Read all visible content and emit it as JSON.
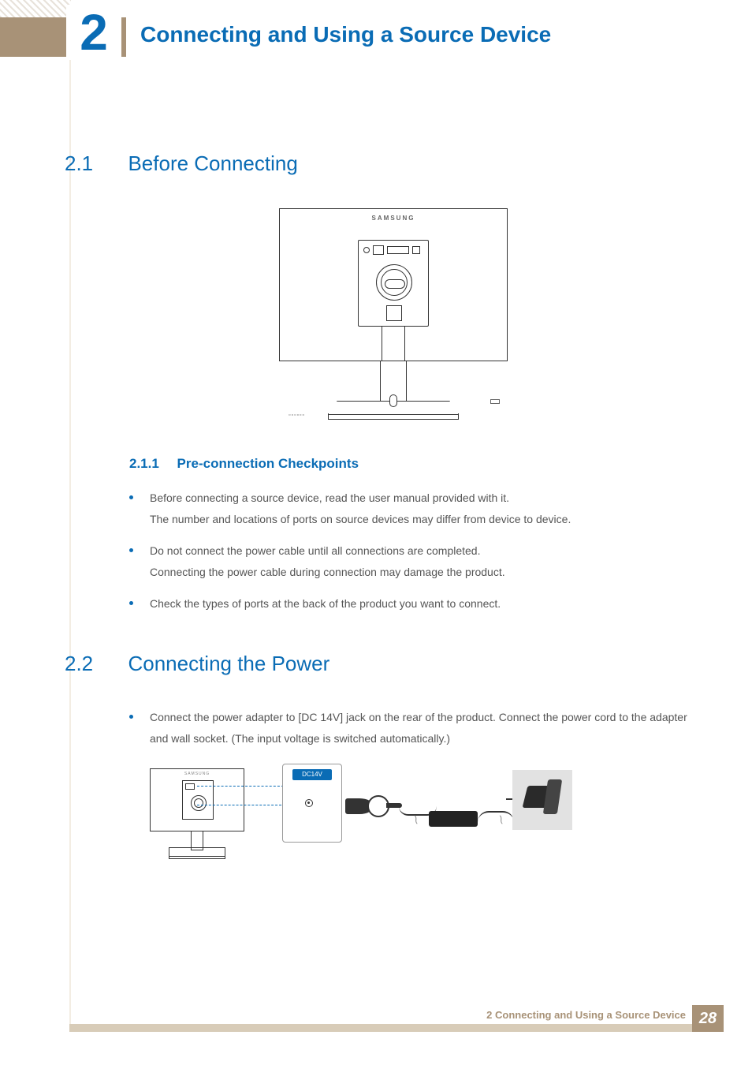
{
  "chapter": {
    "num": "2",
    "title": "Connecting and Using a Source Device"
  },
  "sec1": {
    "num": "2.1",
    "title": "Before Connecting"
  },
  "subsec1": {
    "num": "2.1.1",
    "title": "Pre-connection Checkpoints"
  },
  "bullets1": {
    "b1a": "Before connecting a source device, read the user manual provided with it.",
    "b1b": "The number and locations of ports on source devices may differ from device to device.",
    "b2a": "Do not connect the power cable until all connections are completed.",
    "b2b": "Connecting the power cable during connection may damage the product.",
    "b3": "Check the types of ports at the back of the product you want to connect."
  },
  "sec2": {
    "num": "2.2",
    "title": "Connecting the Power"
  },
  "bullets2": {
    "b1": "Connect the power adapter to [DC 14V] jack on the rear of the product. Connect the power cord to the adapter and wall socket. (The input voltage is switched automatically.)"
  },
  "fig": {
    "brand": "SAMSUNG",
    "dc_label": "DC14V"
  },
  "footer": {
    "text": "2 Connecting and Using a Source Device",
    "page": "28"
  }
}
